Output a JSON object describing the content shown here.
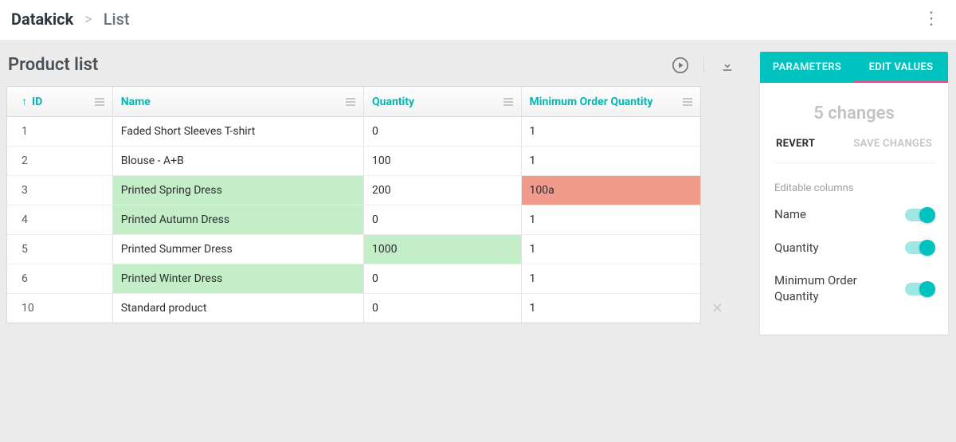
{
  "breadcrumb": {
    "root": "Datakick",
    "leaf": "List"
  },
  "page_title": "Product list",
  "columns": {
    "id": "ID",
    "name": "Name",
    "quantity": "Quantity",
    "minimum": "Minimum Order Quantity"
  },
  "rows": [
    {
      "id": "1",
      "name": "Faded Short Sleeves T-shirt",
      "name_state": "normal",
      "qty": "0",
      "qty_state": "normal",
      "min": "1",
      "min_state": "normal"
    },
    {
      "id": "2",
      "name": "Blouse - A+B",
      "name_state": "normal",
      "qty": "100",
      "qty_state": "normal",
      "min": "1",
      "min_state": "normal"
    },
    {
      "id": "3",
      "name": "Printed Spring Dress",
      "name_state": "edited",
      "qty": "200",
      "qty_state": "normal",
      "min": "100a",
      "min_state": "invalid"
    },
    {
      "id": "4",
      "name": "Printed Autumn Dress",
      "name_state": "edited",
      "qty": "0",
      "qty_state": "normal",
      "min": "1",
      "min_state": "normal"
    },
    {
      "id": "5",
      "name": "Printed Summer Dress",
      "name_state": "normal",
      "qty": "1000",
      "qty_state": "edited",
      "min": "1",
      "min_state": "normal"
    },
    {
      "id": "6",
      "name": "Printed Winter Dress",
      "name_state": "edited",
      "qty": "0",
      "qty_state": "normal",
      "min": "1",
      "min_state": "normal"
    },
    {
      "id": "10",
      "name": "Standard product",
      "name_state": "normal",
      "qty": "0",
      "qty_state": "normal",
      "min": "1",
      "min_state": "normal"
    }
  ],
  "panel": {
    "tabs": {
      "parameters": "PARAMETERS",
      "edit_values": "EDIT VALUES"
    },
    "changes_label": "5 changes",
    "revert_label": "REVERT",
    "save_label": "SAVE CHANGES",
    "editable_label": "Editable columns",
    "toggles": {
      "name": "Name",
      "quantity": "Quantity",
      "minimum": "Minimum Order Quantity"
    }
  },
  "colors": {
    "accent": "#00c3c0",
    "edited_bg": "#c4eec8",
    "invalid_bg": "#f19b8d",
    "tab_underline": "#ff3e7f"
  }
}
